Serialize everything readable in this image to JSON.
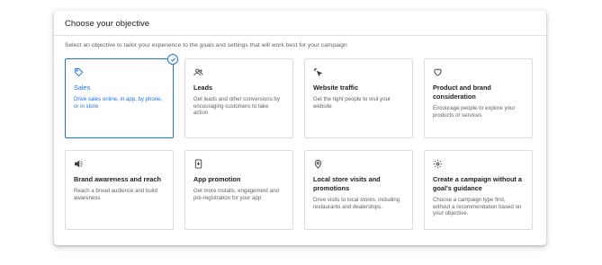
{
  "panel": {
    "title": "Choose your objective",
    "subtitle": "Select an objective to tailor your experience to the goals and settings that will work best for your campaign"
  },
  "objectives": [
    {
      "id": "sales",
      "icon": "tag-icon",
      "title": "Sales",
      "description": "Drive sales online, in app, by phone, or in store",
      "selected": true
    },
    {
      "id": "leads",
      "icon": "people-icon",
      "title": "Leads",
      "description": "Get leads and other conversions by encouraging customers to take action",
      "selected": false
    },
    {
      "id": "website-traffic",
      "icon": "sparkle-cursor-icon",
      "title": "Website traffic",
      "description": "Get the right people to visit your website",
      "selected": false
    },
    {
      "id": "product-brand",
      "icon": "heart-icon",
      "title": "Product and brand consideration",
      "description": "Encourage people to explore your products or services",
      "selected": false
    },
    {
      "id": "brand-awareness",
      "icon": "megaphone-icon",
      "title": "Brand awareness and reach",
      "description": "Reach a broad audience and build awareness",
      "selected": false
    },
    {
      "id": "app-promotion",
      "icon": "phone-download-icon",
      "title": "App promotion",
      "description": "Get more installs, engagement and pre-registration for your app",
      "selected": false
    },
    {
      "id": "local-store",
      "icon": "location-pin-icon",
      "title": "Local store visits and promotions",
      "description": "Drive visits to local stores, including restaurants and dealerships.",
      "selected": false
    },
    {
      "id": "no-goal",
      "icon": "gear-icon",
      "title": "Create a campaign without a goal's guidance",
      "description": "Choose a campaign type first, without a recommendation based on your objective.",
      "selected": false
    }
  ],
  "colors": {
    "accent": "#1a73e8",
    "border": "#dadce0",
    "text": "#202124",
    "muted": "#5f6368"
  }
}
